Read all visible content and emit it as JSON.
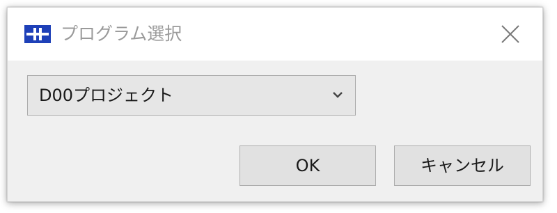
{
  "window": {
    "title": "プログラム選択",
    "app_icon": "app-logo-icon",
    "close_icon": "close-icon"
  },
  "program_select": {
    "selected_value": "D00プロジェクト",
    "dropdown_icon": "chevron-down-icon"
  },
  "buttons": {
    "ok_label": "OK",
    "cancel_label": "キャンセル"
  },
  "colors": {
    "app_icon_bg": "#1e40b8",
    "title_text": "#9a9a9a",
    "dialog_bg": "#f0f0f0",
    "button_bg": "#e1e1e1"
  }
}
